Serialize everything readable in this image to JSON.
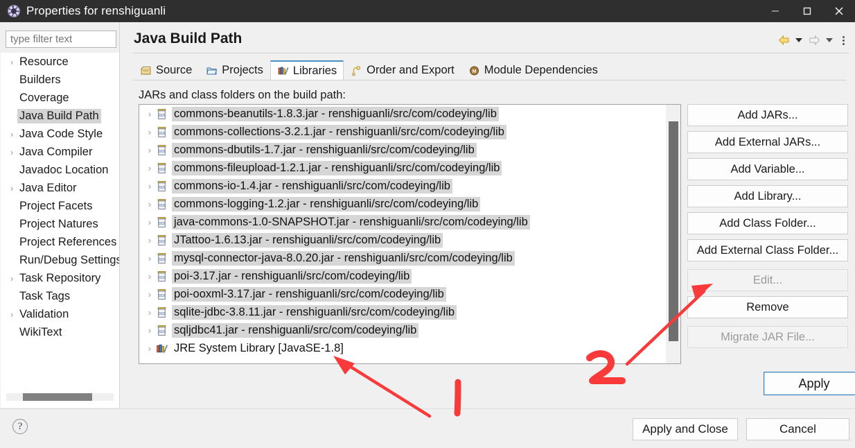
{
  "window": {
    "title": "Properties for renshiguanli",
    "icon": "properties-gear-icon",
    "minimize_label": "Minimize",
    "maximize_label": "Maximize",
    "close_label": "Close"
  },
  "sidebar": {
    "filter": {
      "placeholder": "type filter text",
      "value": ""
    },
    "items": [
      {
        "label": "Resource",
        "expandable": true,
        "selected": false
      },
      {
        "label": "Builders",
        "expandable": false,
        "selected": false
      },
      {
        "label": "Coverage",
        "expandable": false,
        "selected": false
      },
      {
        "label": "Java Build Path",
        "expandable": false,
        "selected": true
      },
      {
        "label": "Java Code Style",
        "expandable": true,
        "selected": false
      },
      {
        "label": "Java Compiler",
        "expandable": true,
        "selected": false
      },
      {
        "label": "Javadoc Location",
        "expandable": false,
        "selected": false
      },
      {
        "label": "Java Editor",
        "expandable": true,
        "selected": false
      },
      {
        "label": "Project Facets",
        "expandable": false,
        "selected": false
      },
      {
        "label": "Project Natures",
        "expandable": false,
        "selected": false
      },
      {
        "label": "Project References",
        "expandable": false,
        "selected": false
      },
      {
        "label": "Run/Debug Settings",
        "expandable": false,
        "selected": false
      },
      {
        "label": "Task Repository",
        "expandable": true,
        "selected": false
      },
      {
        "label": "Task Tags",
        "expandable": false,
        "selected": false
      },
      {
        "label": "Validation",
        "expandable": true,
        "selected": false
      },
      {
        "label": "WikiText",
        "expandable": false,
        "selected": false
      }
    ]
  },
  "page": {
    "title": "Java Build Path",
    "nav": {
      "back_label": "Back",
      "back_menu_label": "Back history",
      "forward_label": "Forward",
      "forward_menu_label": "Forward history",
      "view_menu_label": "View menu"
    }
  },
  "tabs": [
    {
      "label": "Source",
      "icon": "package-icon",
      "active": false
    },
    {
      "label": "Projects",
      "icon": "folder-icon",
      "active": false
    },
    {
      "label": "Libraries",
      "icon": "library-books-icon",
      "active": true
    },
    {
      "label": "Order and Export",
      "icon": "order-export-icon",
      "active": false
    },
    {
      "label": "Module Dependencies",
      "icon": "module-badge-icon",
      "active": false
    }
  ],
  "libraries": {
    "list_label": "JARs and class folders on the build path:",
    "entries": [
      {
        "label": "commons-beanutils-1.8.3.jar - renshiguanli/src/com/codeying/lib",
        "icon": "jar-icon",
        "highlighted": true
      },
      {
        "label": "commons-collections-3.2.1.jar - renshiguanli/src/com/codeying/lib",
        "icon": "jar-icon",
        "highlighted": true
      },
      {
        "label": "commons-dbutils-1.7.jar - renshiguanli/src/com/codeying/lib",
        "icon": "jar-icon",
        "highlighted": true
      },
      {
        "label": "commons-fileupload-1.2.1.jar - renshiguanli/src/com/codeying/lib",
        "icon": "jar-icon",
        "highlighted": true
      },
      {
        "label": "commons-io-1.4.jar - renshiguanli/src/com/codeying/lib",
        "icon": "jar-icon",
        "highlighted": true
      },
      {
        "label": "commons-logging-1.2.jar - renshiguanli/src/com/codeying/lib",
        "icon": "jar-icon",
        "highlighted": true
      },
      {
        "label": "java-commons-1.0-SNAPSHOT.jar - renshiguanli/src/com/codeying/lib",
        "icon": "jar-icon",
        "highlighted": true
      },
      {
        "label": "JTattoo-1.6.13.jar - renshiguanli/src/com/codeying/lib",
        "icon": "jar-icon",
        "highlighted": true
      },
      {
        "label": "mysql-connector-java-8.0.20.jar - renshiguanli/src/com/codeying/lib",
        "icon": "jar-icon",
        "highlighted": true
      },
      {
        "label": "poi-3.17.jar - renshiguanli/src/com/codeying/lib",
        "icon": "jar-icon",
        "highlighted": true
      },
      {
        "label": "poi-ooxml-3.17.jar - renshiguanli/src/com/codeying/lib",
        "icon": "jar-icon",
        "highlighted": true
      },
      {
        "label": "sqlite-jdbc-3.8.11.jar - renshiguanli/src/com/codeying/lib",
        "icon": "jar-icon",
        "highlighted": true
      },
      {
        "label": "sqljdbc41.jar - renshiguanli/src/com/codeying/lib",
        "icon": "jar-icon",
        "highlighted": true
      },
      {
        "label": "JRE System Library [JavaSE-1.8]",
        "icon": "library-books-icon",
        "highlighted": false
      }
    ],
    "buttons": [
      {
        "label": "Add JARs...",
        "enabled": true,
        "gap": false
      },
      {
        "label": "Add External JARs...",
        "enabled": true,
        "gap": false
      },
      {
        "label": "Add Variable...",
        "enabled": true,
        "gap": false
      },
      {
        "label": "Add Library...",
        "enabled": true,
        "gap": false
      },
      {
        "label": "Add Class Folder...",
        "enabled": true,
        "gap": false
      },
      {
        "label": "Add External Class Folder...",
        "enabled": true,
        "gap": false
      },
      {
        "label": "Edit...",
        "enabled": false,
        "gap": true
      },
      {
        "label": "Remove",
        "enabled": true,
        "gap": false
      },
      {
        "label": "Migrate JAR File...",
        "enabled": false,
        "gap": true
      }
    ],
    "apply_label": "Apply"
  },
  "footer": {
    "help_label": "?",
    "apply_and_close_label": "Apply and Close",
    "cancel_label": "Cancel"
  },
  "annotations": [
    {
      "name": "arrow-1",
      "number": "1",
      "points_to": "JRE System Library [JavaSE-1.8]",
      "color": "#f93a3a"
    },
    {
      "name": "arrow-2",
      "number": "2",
      "points_to": "Edit...",
      "color": "#f93a3a"
    }
  ],
  "colors": {
    "titlebar_bg": "#2f2f2f",
    "dialog_bg": "#f0f0f0",
    "selection": "#d4d4d4",
    "row_highlight": "#d6d6d6",
    "active_tab_accent": "#4a90c4",
    "apply_focus_border": "#3a7fb5",
    "annotation_red": "#f93a3a"
  }
}
